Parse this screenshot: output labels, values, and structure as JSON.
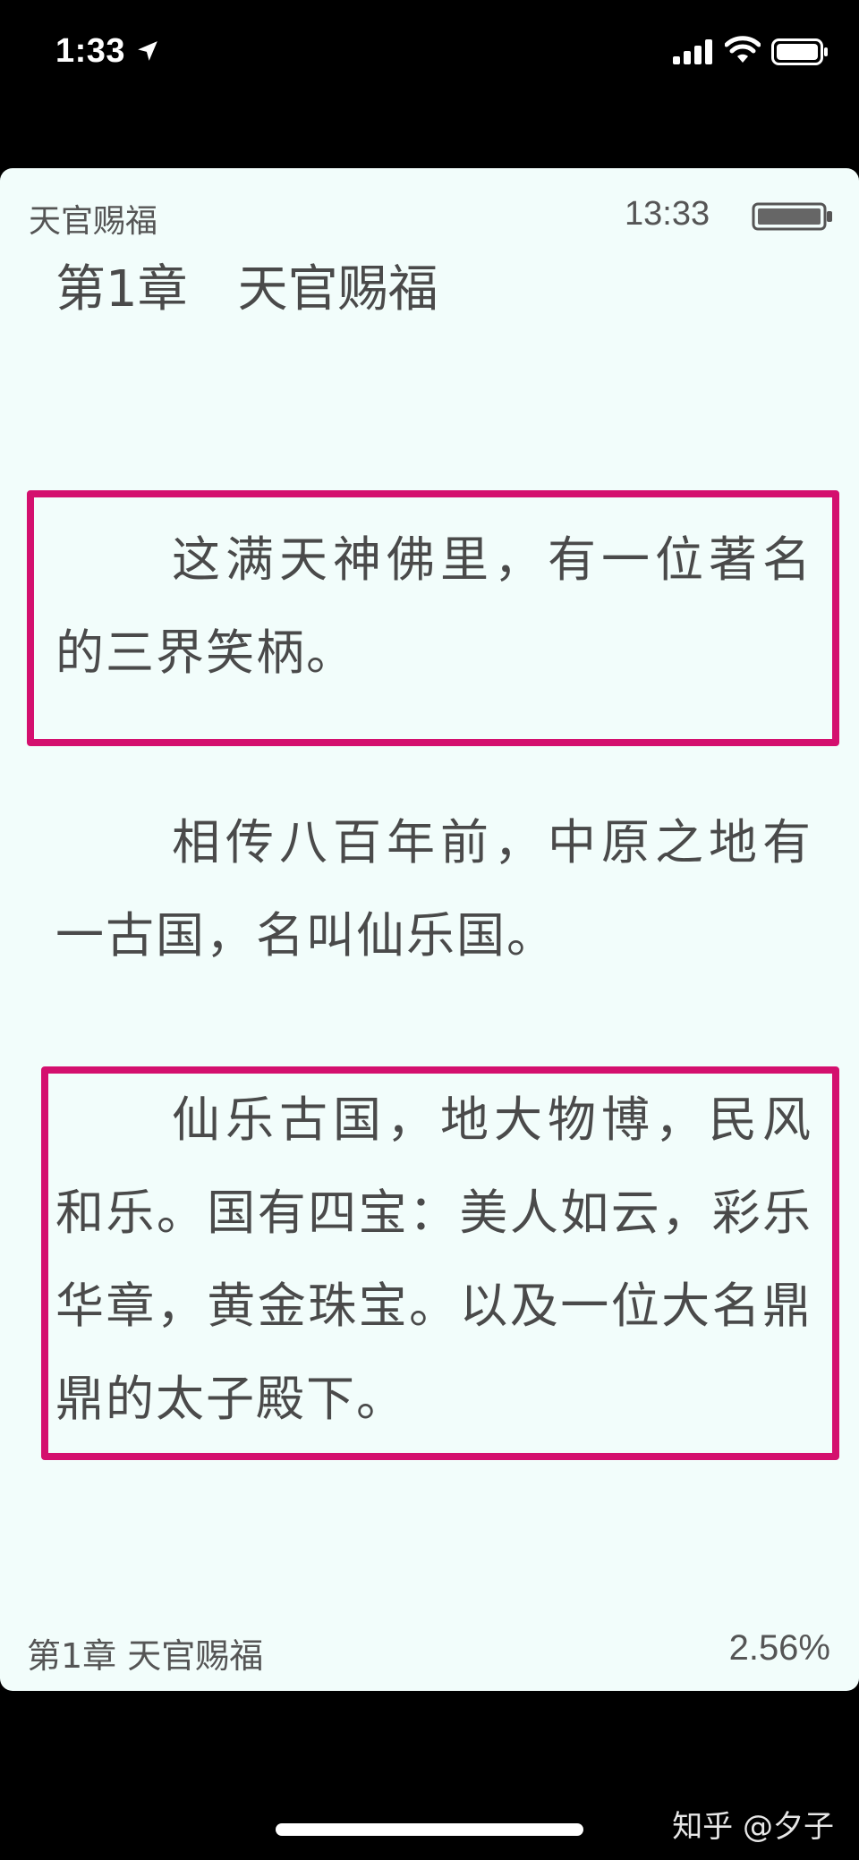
{
  "status_bar": {
    "time": "1:33",
    "icons": [
      "location-arrow-icon",
      "cellular-signal-icon",
      "wifi-icon",
      "battery-icon"
    ]
  },
  "reader": {
    "book_title": "天官赐福",
    "clock": "13:33",
    "chapter_heading": "第1章　天官赐福",
    "paragraphs": [
      "这满天神佛里，有一位著名的三界笑柄。",
      "相传八百年前，中原之地有一古国，名叫仙乐国。",
      "仙乐古国，地大物博，民风和乐。国有四宝：美人如云，彩乐华章，黄金珠宝。以及一位大名鼎鼎的太子殿下。"
    ],
    "footer_chapter": "第1章 天官赐福",
    "progress_text": "2.56%"
  },
  "watermark": "知乎 @夕子",
  "colors": {
    "page_background": "#f2fdfb",
    "text": "#4a4a4a",
    "highlight": "#d4106e",
    "screen_background": "#000000"
  }
}
